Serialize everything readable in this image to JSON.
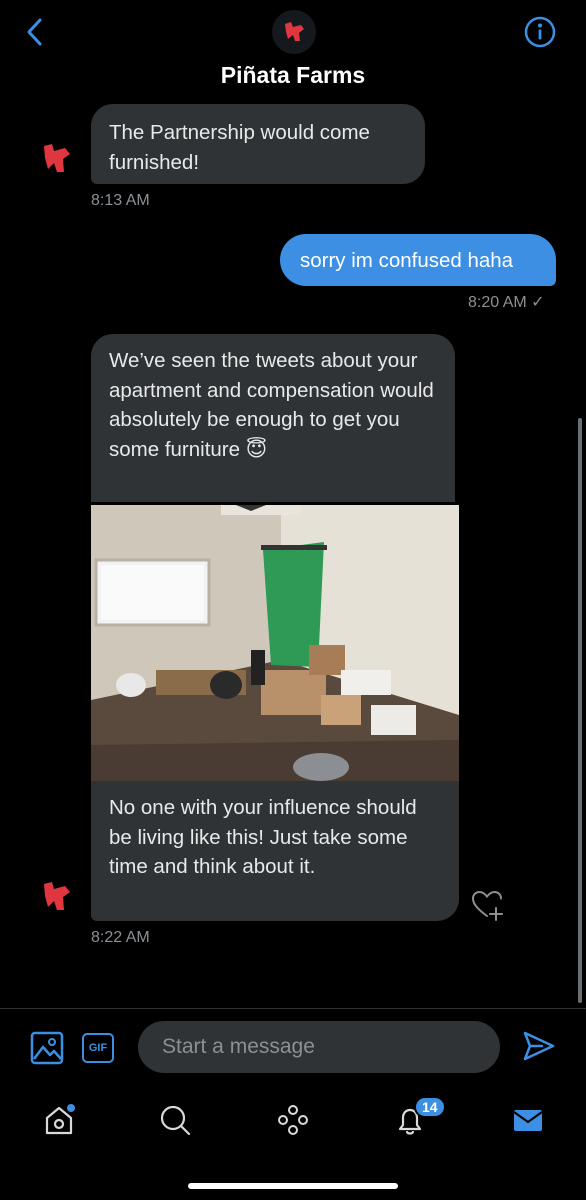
{
  "header": {
    "title": "Piñata Farms",
    "back_icon": "chevron-left-icon",
    "info_icon": "info-icon"
  },
  "messages": [
    {
      "from": "them",
      "text": "The Partnership would come furnished!",
      "time": "8:13 AM"
    },
    {
      "from": "me",
      "text": "sorry im confused haha",
      "time": "8:20 AM ✓"
    },
    {
      "from": "them",
      "text": "We’ve seen the tweets about your apartment and compensation would absolutely be enough to get you some furniture 😇"
    },
    {
      "from": "them",
      "type": "image",
      "alt": "photo of a mostly empty apartment room"
    },
    {
      "from": "them",
      "text": "No one with your influence should be living like this! Just take some time and think about it.",
      "time": "8:22 AM"
    }
  ],
  "composer": {
    "placeholder": "Start a message",
    "gif_label": "GIF"
  },
  "tabbar": {
    "notifications_badge": "14"
  },
  "colors": {
    "accent": "#3c8fe3",
    "received_bubble": "#2f3336",
    "brand_red": "#e0363f"
  }
}
